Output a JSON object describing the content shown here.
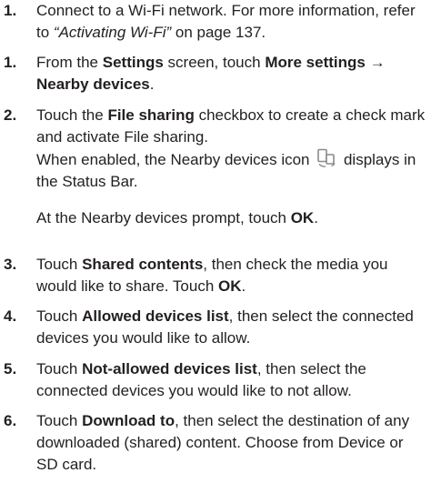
{
  "steps": [
    {
      "num": "1.",
      "parts": [
        {
          "t": "Connect to a Wi-Fi network. For more information, refer to "
        },
        {
          "t": "“Activating Wi-Fi”",
          "i": true
        },
        {
          "t": " on page 137."
        }
      ]
    },
    {
      "num": "1.",
      "parts": [
        {
          "t": "From the "
        },
        {
          "t": "Settings",
          "b": true
        },
        {
          "t": " screen, touch "
        },
        {
          "t": "More settings → Nearby devices",
          "b": true
        },
        {
          "t": "."
        }
      ]
    },
    {
      "num": "2.",
      "parts": [
        {
          "t": "Touch the "
        },
        {
          "t": "File sharing",
          "b": true
        },
        {
          "t": " checkbox to create a check mark and activate File sharing."
        }
      ]
    },
    {
      "num": "",
      "parts": [
        {
          "t": "When enabled, the Nearby devices icon "
        },
        {
          "icon": "nearby-devices-icon"
        },
        {
          "t": " displays in the Status Bar."
        }
      ]
    },
    {
      "num": "",
      "parts": [
        {
          "t": "At the Nearby devices prompt, touch "
        },
        {
          "t": "OK",
          "b": true
        },
        {
          "t": "."
        }
      ]
    },
    {
      "num": "3.",
      "parts": [
        {
          "t": "Touch "
        },
        {
          "t": "Shared contents",
          "b": true
        },
        {
          "t": ", then check the media you would like to share. Touch "
        },
        {
          "t": "OK",
          "b": true
        },
        {
          "t": "."
        }
      ]
    },
    {
      "num": "4.",
      "parts": [
        {
          "t": "Touch "
        },
        {
          "t": "Allowed devices list",
          "b": true
        },
        {
          "t": ", then select the connected devices you would like to allow."
        }
      ]
    },
    {
      "num": "5.",
      "parts": [
        {
          "t": "Touch "
        },
        {
          "t": "Not-allowed devices list",
          "b": true
        },
        {
          "t": ", then select the connected devices you would like to not allow."
        }
      ]
    },
    {
      "num": "6.",
      "parts": [
        {
          "t": "Touch "
        },
        {
          "t": "Download to",
          "b": true
        },
        {
          "t": ", then select the destination of any downloaded (shared) content. Choose from Device or SD card."
        }
      ]
    }
  ]
}
